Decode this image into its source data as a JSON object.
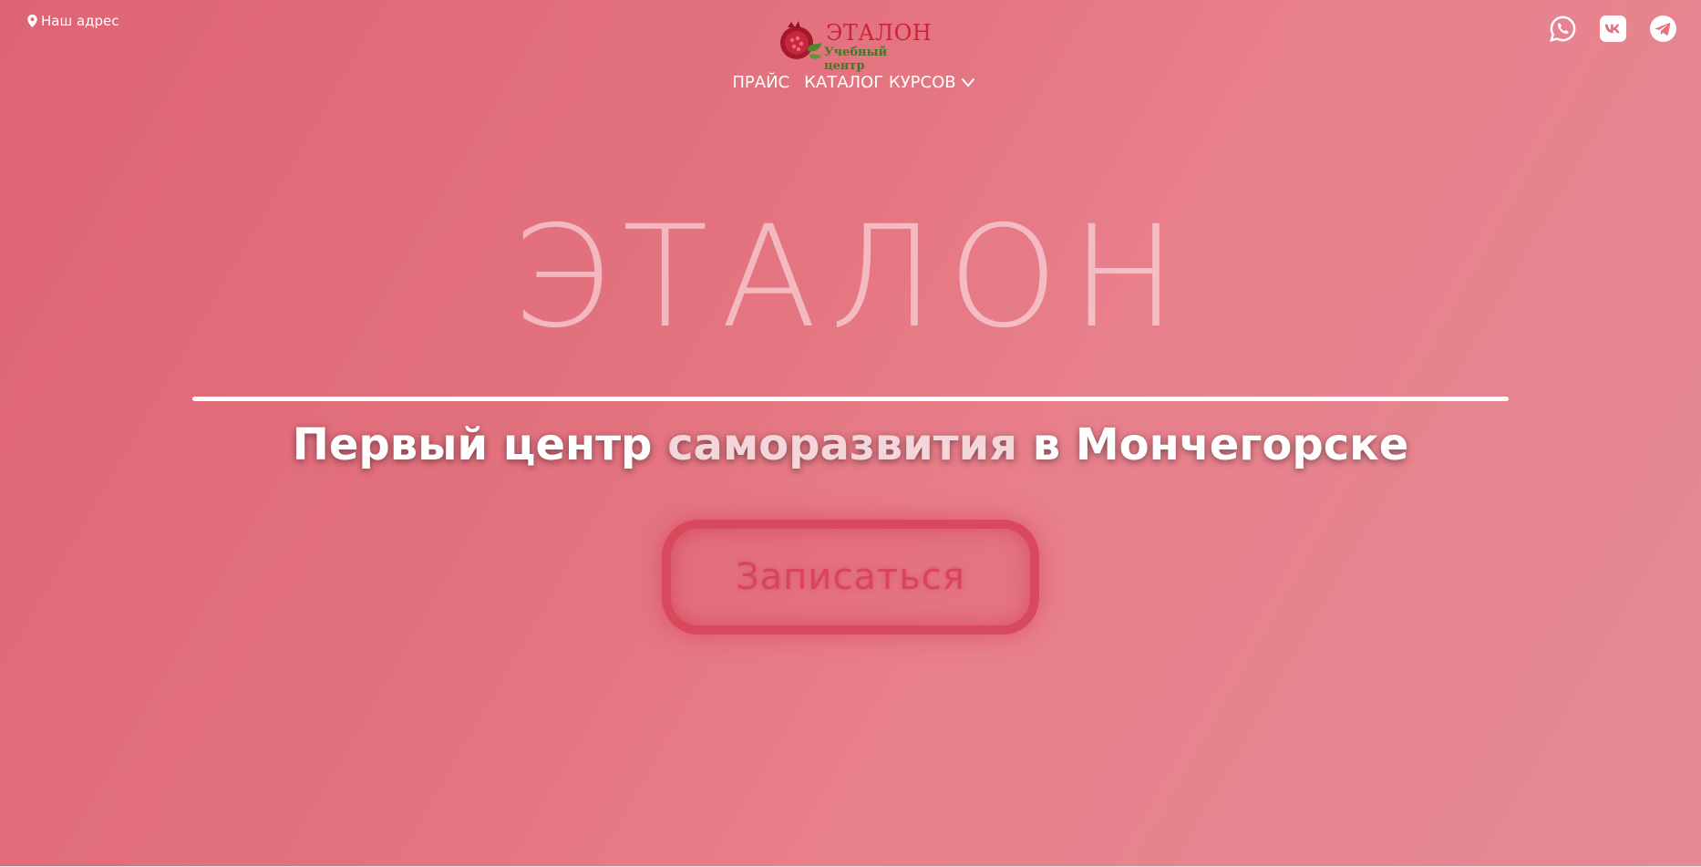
{
  "header": {
    "address_label": "Наш адрес",
    "logo": {
      "title": "ЭТАЛОН",
      "subtitle": "Учебный центр"
    },
    "nav": [
      {
        "label": "ПРАЙС"
      },
      {
        "label": "КАТАЛОГ КУРСОВ"
      }
    ],
    "socials": [
      {
        "icon": "whatsapp-icon"
      },
      {
        "icon": "vk-icon"
      },
      {
        "icon": "telegram-icon"
      }
    ]
  },
  "hero": {
    "title": "ЭТАЛОН",
    "subtitle_part1": "Первый центр ",
    "subtitle_part2": "саморазвития",
    "subtitle_part3": " в Мончегорске",
    "cta_label": "Записаться"
  },
  "colors": {
    "background": "#e3737f",
    "cta_border": "#d8495d",
    "logo_title": "#c9243b",
    "logo_subtitle": "#3f7a25"
  }
}
